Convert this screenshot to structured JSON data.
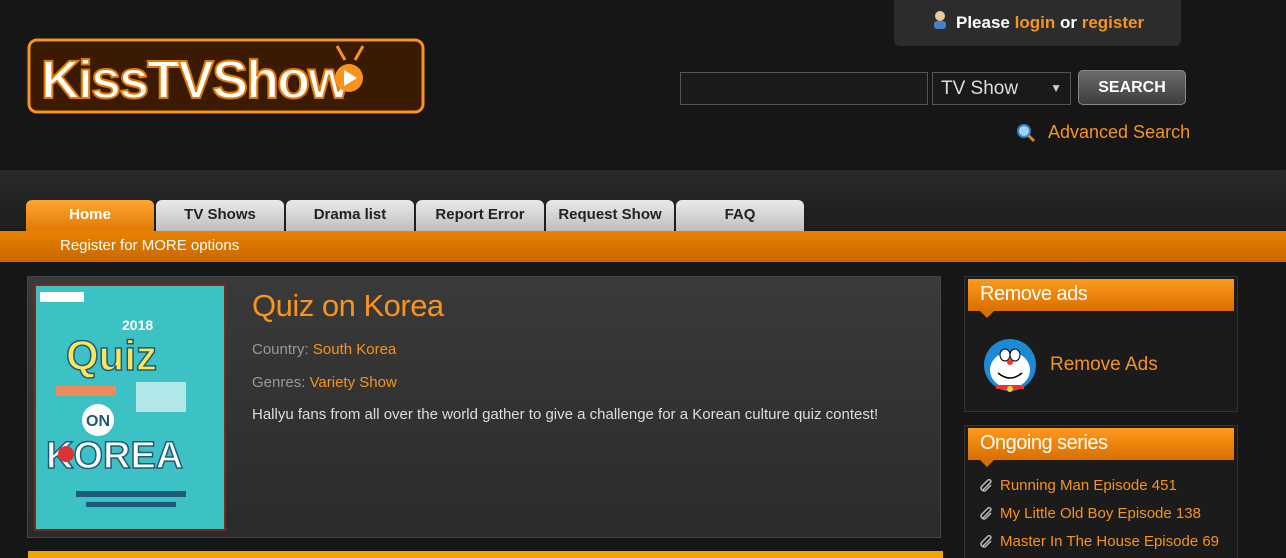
{
  "header": {
    "logo_text": "KissTVShow",
    "login": {
      "please": "Please",
      "login": "login",
      "or": "or",
      "register": "register"
    },
    "search": {
      "input_value": "",
      "select_value": "TV Show",
      "button": "SEARCH"
    },
    "advanced_search": "Advanced Search"
  },
  "nav": {
    "tabs": [
      "Home",
      "TV Shows",
      "Drama list",
      "Report Error",
      "Request Show",
      "FAQ"
    ],
    "register_text": "Register for MORE options"
  },
  "show": {
    "title": "Quiz on Korea",
    "country_label": "Country:",
    "country": "South Korea",
    "genres_label": "Genres:",
    "genres": "Variety Show",
    "description": "Hallyu fans from all over the world gather to give a challenge for a Korean culture quiz contest!",
    "poster": {
      "year": "2018",
      "title1": "Quiz",
      "title2": "ON",
      "title3": "KOREA"
    }
  },
  "sidebar": {
    "remove_ads_title": "Remove ads",
    "remove_ads_link": "Remove Ads",
    "ongoing_title": "Ongoing series",
    "ongoing": [
      "Running Man Episode 451",
      "My Little Old Boy Episode 138",
      "Master In The House Episode 69"
    ]
  },
  "colors": {
    "accent": "#f7931e",
    "bar": "#e07800",
    "background": "#161616"
  }
}
